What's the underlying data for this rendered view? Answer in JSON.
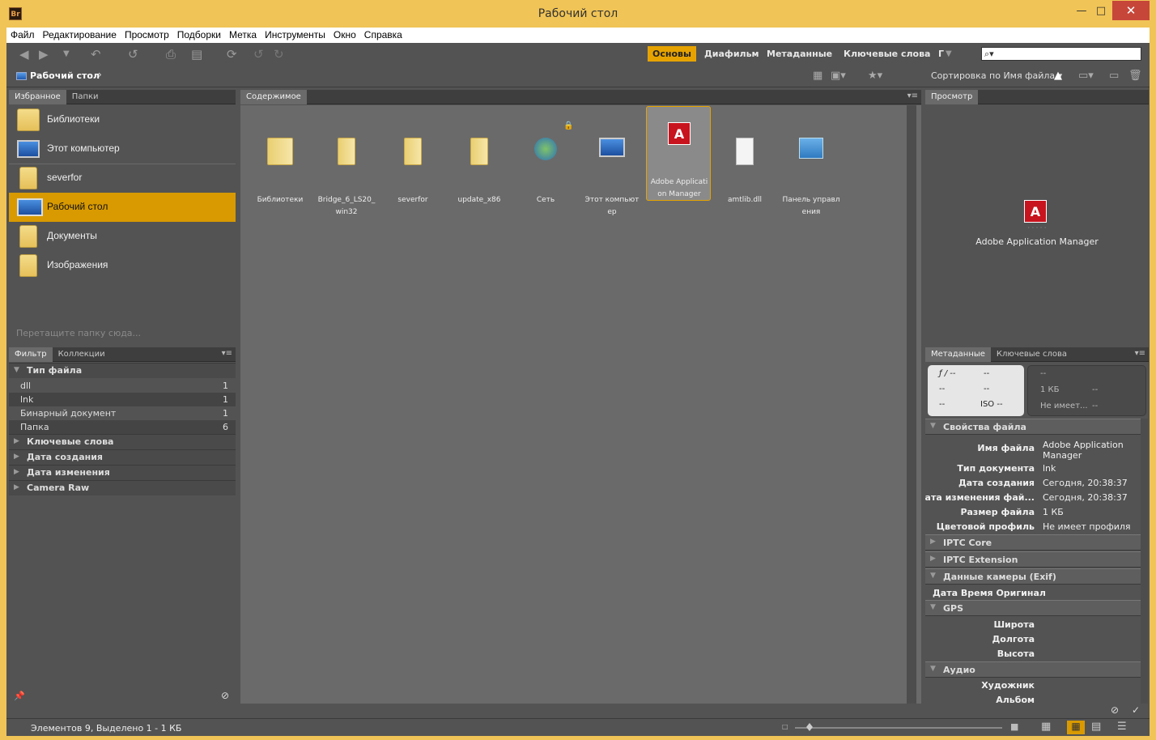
{
  "window": {
    "app_icon": "Br",
    "title": "Рабочий стол",
    "controls": {
      "minimize": "—",
      "maximize": "□",
      "close": "✕"
    }
  },
  "menu": [
    "Файл",
    "Редактирование",
    "Просмотр",
    "Подборки",
    "Метка",
    "Инструменты",
    "Окно",
    "Справка"
  ],
  "workspaces": {
    "items": [
      "Основы",
      "Диафильм",
      "Метаданные",
      "Ключевые слова",
      "Г"
    ],
    "active": "Основы"
  },
  "search": {
    "value": "⌕▾"
  },
  "breadcrumb": {
    "label": "Рабочий стол",
    "chevron": "›"
  },
  "sort": {
    "label": "Сортировка по Имя файла ▾"
  },
  "favorites_panel": {
    "tabs": [
      "Избранное",
      "Папки"
    ],
    "items": [
      {
        "label": "Библиотеки",
        "icon": "libraries-icon"
      },
      {
        "label": "Этот компьютер",
        "icon": "computer-icon"
      },
      {
        "label": "severfor",
        "icon": "folder-icon"
      },
      {
        "label": "Рабочий стол",
        "icon": "desktop-icon",
        "selected": true
      },
      {
        "label": "Документы",
        "icon": "documents-icon"
      },
      {
        "label": "Изображения",
        "icon": "pictures-icon"
      }
    ],
    "hint": "Перетащите папку сюда..."
  },
  "filter_panel": {
    "tabs": [
      "Фильтр",
      "Коллекции"
    ],
    "file_type_header": "Тип файла",
    "file_types": [
      {
        "label": "dll",
        "count": "1"
      },
      {
        "label": "lnk",
        "count": "1"
      },
      {
        "label": "Бинарный документ",
        "count": "1"
      },
      {
        "label": "Папка",
        "count": "6"
      }
    ],
    "groups": [
      "Ключевые слова",
      "Дата создания",
      "Дата изменения",
      "Camera Raw"
    ]
  },
  "content_panel": {
    "tab": "Содержимое",
    "items": [
      {
        "line1": "Библиотеки",
        "line2": "",
        "icon": "libraries-icon"
      },
      {
        "line1": "Bridge_6_LS20_",
        "line2": "win32",
        "icon": "folder-icon"
      },
      {
        "line1": "severfor",
        "line2": "",
        "icon": "folder-icon"
      },
      {
        "line1": "update_x86",
        "line2": "",
        "icon": "folder-icon"
      },
      {
        "line1": "Сеть",
        "line2": "",
        "icon": "network-icon"
      },
      {
        "line1": "Этот компьют",
        "line2": "ер",
        "icon": "computer-icon"
      },
      {
        "line1": "Adobe Applicati",
        "line2": "on Manager",
        "icon": "adobe-shortcut-icon",
        "selected": true
      },
      {
        "line1": "amtlib.dll",
        "line2": "",
        "icon": "dll-file-icon"
      },
      {
        "line1": "Панель управл",
        "line2": "ения",
        "icon": "control-panel-icon"
      }
    ]
  },
  "preview_panel": {
    "tab": "Просмотр",
    "name": "Adobe Application Manager",
    "dots": "· · · · ·"
  },
  "metadata_panel": {
    "tabs": [
      "Метаданные",
      "Ключевые слова"
    ],
    "camera": {
      "aperture": "ƒ / --",
      "shutter": "--",
      "r2a": "--",
      "r2b": "--",
      "r3a": "--",
      "iso": "ISO --",
      "r1": "--",
      "size": "1 КБ",
      "size_extra": "--",
      "profile": "Не имеет...",
      "profile_extra": "--"
    },
    "file_props_header": "Свойства файла",
    "file_props": [
      {
        "key": "Имя файла",
        "value": "Adobe Application Manager"
      },
      {
        "key": "Тип документа",
        "value": "lnk"
      },
      {
        "key": "Дата создания",
        "value": "Сегодня, 20:38:37"
      },
      {
        "key": "Дата изменения фай...",
        "value": "Сегодня, 20:38:37"
      },
      {
        "key": "Размер файла",
        "value": "1 КБ"
      },
      {
        "key": "Цветовой профиль",
        "value": "Не имеет профиля"
      }
    ],
    "group_iptc_core": "IPTC Core",
    "group_iptc_ext": "IPTC Extension",
    "group_exif": "Данные камеры (Exif)",
    "exif_row": "Дата Время Оригинал",
    "group_gps": "GPS",
    "gps_rows": [
      "Широта",
      "Долгота",
      "Высота"
    ],
    "group_audio": "Аудио",
    "audio_rows": [
      "Художник",
      "Альбом"
    ]
  },
  "status": {
    "text": "Элементов 9, Выделено 1 - 1 КБ"
  },
  "colors": {
    "accent": "#e6a300",
    "frame": "#f0c456",
    "panel": "#535353",
    "content_bg": "#6a6a6a"
  }
}
